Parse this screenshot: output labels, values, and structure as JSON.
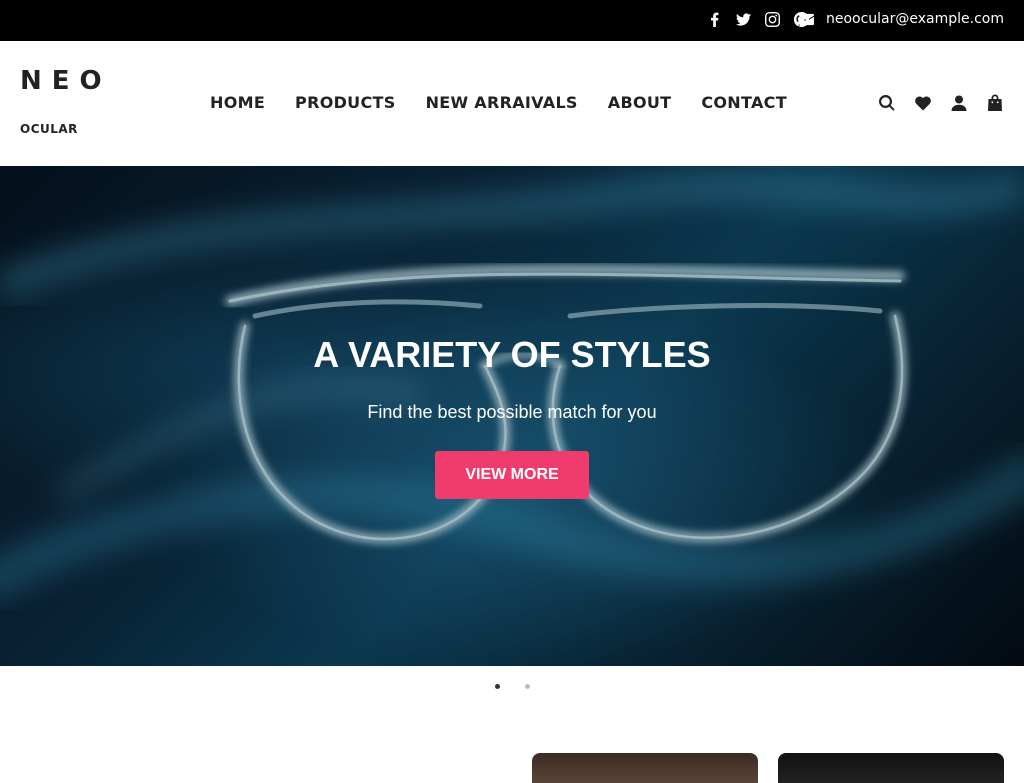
{
  "topbar": {
    "social_icons": [
      "facebook-icon",
      "twitter-icon",
      "instagram-icon",
      "pinterest-icon"
    ],
    "email_icon": "envelope-icon",
    "email": "neoocular@example.com"
  },
  "header": {
    "logo_main": "NEO",
    "logo_sub": "OCULAR",
    "nav": [
      "HOME",
      "PRODUCTS",
      "NEW ARRAIVALS",
      "ABOUT",
      "CONTACT"
    ],
    "icons": [
      "search-icon",
      "heart-icon",
      "user-icon",
      "shopping-bag-icon"
    ]
  },
  "hero": {
    "title": "A VARIETY OF STYLES",
    "subtitle": "Find the best possible match for you",
    "button": "VIEW MORE"
  },
  "carousel": {
    "slides": 2,
    "active": 1
  },
  "colors": {
    "topbar_bg": "#000000",
    "accent": "#ef3b6e",
    "dot_active": "#333333",
    "dot_inactive": "#bbbbbb"
  }
}
